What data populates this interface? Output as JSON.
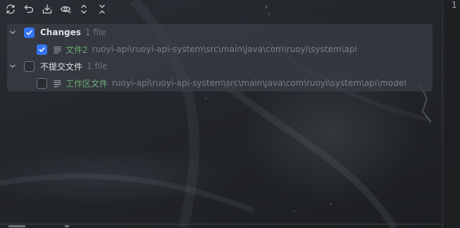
{
  "toolbar": {
    "icons": [
      "refresh-icon",
      "rollback-icon",
      "shelve-icon",
      "eye-icon",
      "expand-all-icon",
      "collapse-all-icon"
    ]
  },
  "gutter": {
    "line_number": "1"
  },
  "changes": {
    "groups": [
      {
        "label": "Changes",
        "count": "1 file",
        "checked": true,
        "files": [
          {
            "name": "文件2",
            "path": "ruoyi-api\\ruoyi-api-system\\src\\main\\java\\com\\ruoyi\\system\\api",
            "checked": true
          }
        ]
      },
      {
        "label": "不提交文件",
        "count": "1 file",
        "checked": false,
        "files": [
          {
            "name": "工作区文件",
            "path": "ruoyi-api\\ruoyi-api-system\\src\\main\\java\\com\\ruoyi\\system\\api\\model",
            "checked": false
          }
        ]
      }
    ]
  },
  "colors": {
    "accent": "#3574f0",
    "file_name": "#6aab73",
    "path": "#7a7e85",
    "count": "#6f737a",
    "panel": "#3c3f46"
  }
}
